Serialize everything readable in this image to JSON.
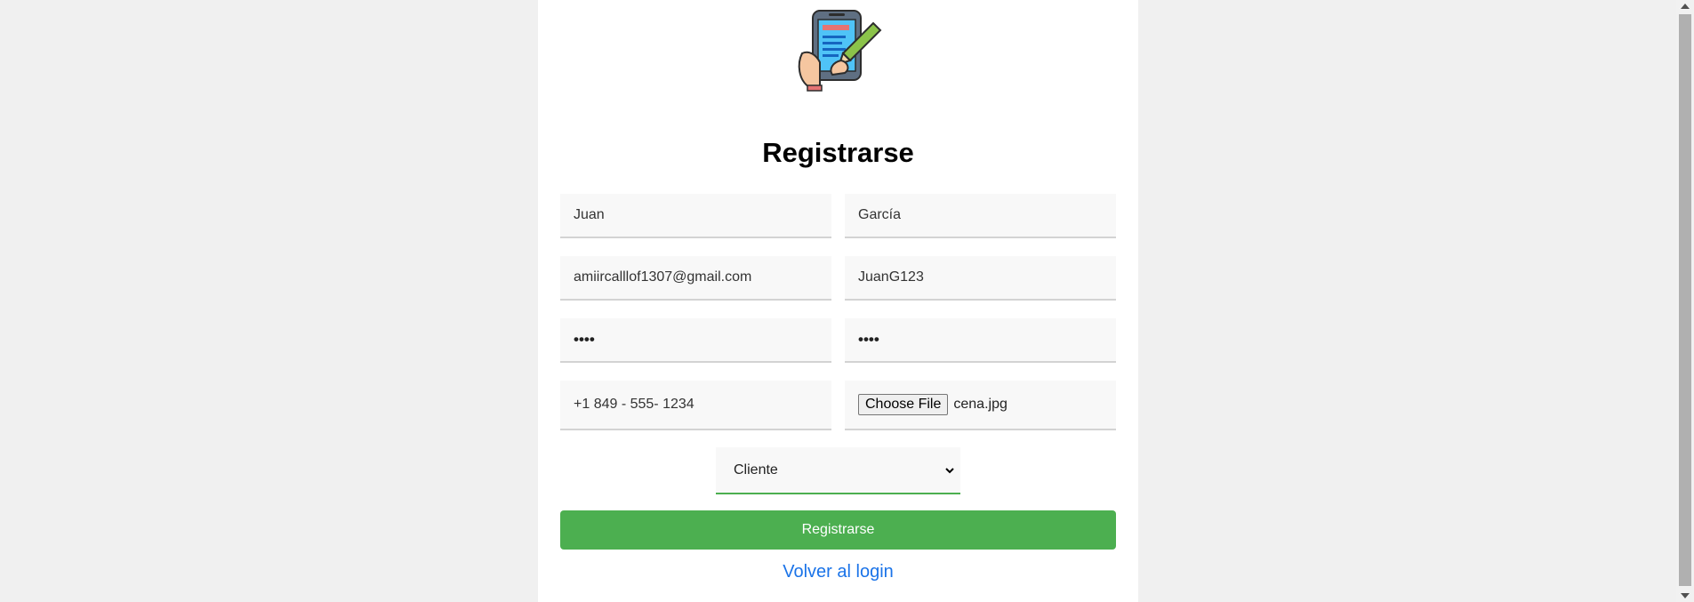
{
  "form": {
    "title": "Registrarse",
    "logo_icon": "phone-signup-icon",
    "nombre": "Juan",
    "apellido": "García",
    "email": "amiircalllof1307@gmail.com",
    "usuario": "JuanG123",
    "password": "••••",
    "password_confirm": "••••",
    "telefono": "+1 849 - 555- 1234",
    "file_button": "Choose File",
    "file_name": "cena.jpg",
    "rol": "Cliente",
    "submit_label": "Registrarse",
    "login_link": "Volver al login"
  },
  "colors": {
    "accent": "#4caf50",
    "link": "#1a73e8",
    "background": "#f0f0f0"
  }
}
